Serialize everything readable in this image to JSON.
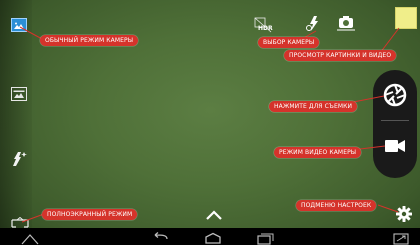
{
  "topbar": {
    "hdr_label": "HDR"
  },
  "callouts": {
    "normal_mode": "ОБЫЧНЫЙ РЕЖИМ КАМЕРЫ",
    "camera_select": "ВЫБОР КАМЕРЫ",
    "preview": "ПРОСМОТР КАРТИНКИ И ВИДЕО",
    "take_photo": "НАЖМИТЕ ДЛЯ СЪЕМКИ",
    "video_mode": "РЕЖИМ ВИДЕО КАМЕРЫ",
    "settings_menu": "ПОДМЕНЮ НАСТРОЕК",
    "fullscreen_mode": "ПОЛНОЭКРАННЫЙ РЕЖИМ"
  },
  "colors": {
    "callout": "#d5332b",
    "viewfinder": "#4f7038",
    "panel": "#1a1a1a",
    "thumbnail": "#f0ee8a",
    "mode_active": "#2b8fd6"
  },
  "icons": {
    "left": [
      "camera-mode-icon",
      "panorama-mode-icon",
      "effects-mode-icon",
      "fullscreen-mode-icon"
    ],
    "top": [
      "hdr-icon",
      "flash-auto-icon",
      "switch-camera-icon"
    ],
    "right": [
      "shutter-icon",
      "video-camera-icon",
      "gear-icon"
    ],
    "nav": [
      "back-icon",
      "home-icon",
      "recents-icon",
      "screenshot-icon"
    ]
  }
}
